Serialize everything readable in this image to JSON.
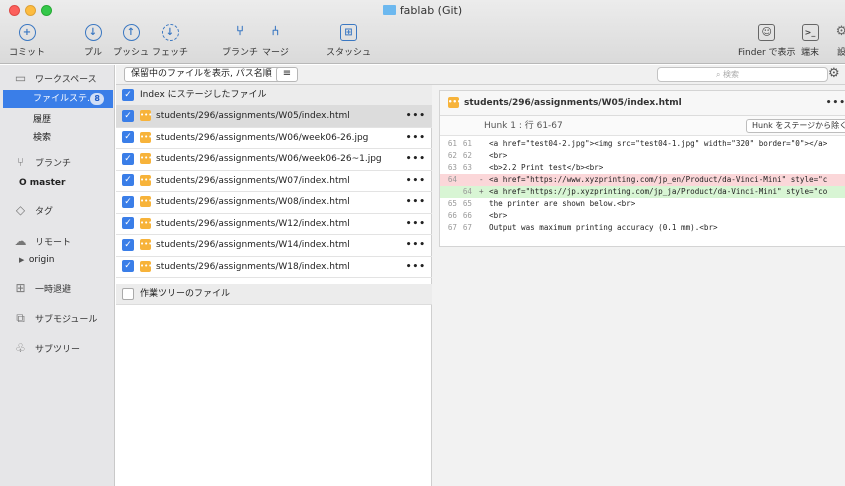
{
  "window": {
    "title": "fablab (Git)"
  },
  "toolbar": {
    "commit": "コミット",
    "pull": "プル",
    "push": "プッシュ",
    "fetch": "フェッチ",
    "branch": "ブランチ",
    "merge": "マージ",
    "stash": "スタッシュ",
    "finder": "Finder で表示",
    "terminal": "端末",
    "settings": "設"
  },
  "sidebar": {
    "workspace": "ワークスペース",
    "file_status": "ファイルステ...",
    "file_status_count": "8",
    "history": "履歴",
    "search": "検索",
    "branches": "ブランチ",
    "branch_master": "master",
    "tags": "タグ",
    "remotes": "リモート",
    "remote_origin": "origin",
    "stashes": "一時退避",
    "submodules": "サブモジュール",
    "subtrees": "サブツリー"
  },
  "filter": {
    "dropdown": "保留中のファイルを表示, パス名順",
    "search_placeholder": "検索"
  },
  "staged": {
    "header": "Index にステージしたファイル",
    "files": [
      "students/296/assignments/W05/index.html",
      "students/296/assignments/W06/week06-26.jpg",
      "students/296/assignments/W06/week06-26~1.jpg",
      "students/296/assignments/W07/index.html",
      "students/296/assignments/W08/index.html",
      "students/296/assignments/W12/index.html",
      "students/296/assignments/W14/index.html",
      "students/296/assignments/W18/index.html"
    ]
  },
  "unstaged": {
    "header": "作業ツリーのファイル"
  },
  "diff": {
    "file": "students/296/assignments/W05/index.html",
    "hunk_title": "Hunk 1 : 行 61-67",
    "hunk_button": "Hunk をステージから除く",
    "lines": [
      {
        "o": "61",
        "n": "61",
        "s": "",
        "t": "<a href=\"test04-2.jpg\"><img src=\"test04-1.jpg\" width=\"320\" border=\"0\"></a>"
      },
      {
        "o": "62",
        "n": "62",
        "s": "",
        "t": "<br>"
      },
      {
        "o": "63",
        "n": "63",
        "s": "",
        "t": "<b>2.2 Print test</b><br>"
      },
      {
        "o": "64",
        "n": "",
        "s": "-",
        "t": "<a href=\"https://www.xyzprinting.com/jp_en/Product/da-Vinci-Mini\" style=\"c"
      },
      {
        "o": "",
        "n": "64",
        "s": "+",
        "t": "<a href=\"https://jp.xyzprinting.com/jp_ja/Product/da-Vinci-Mini\" style=\"co"
      },
      {
        "o": "65",
        "n": "65",
        "s": "",
        "t": " the printer are shown below.<br>"
      },
      {
        "o": "66",
        "n": "66",
        "s": "",
        "t": "<br>"
      },
      {
        "o": "67",
        "n": "67",
        "s": "",
        "t": "Output was  maximum printing accuracy (0.1 mm).<br>"
      }
    ]
  }
}
